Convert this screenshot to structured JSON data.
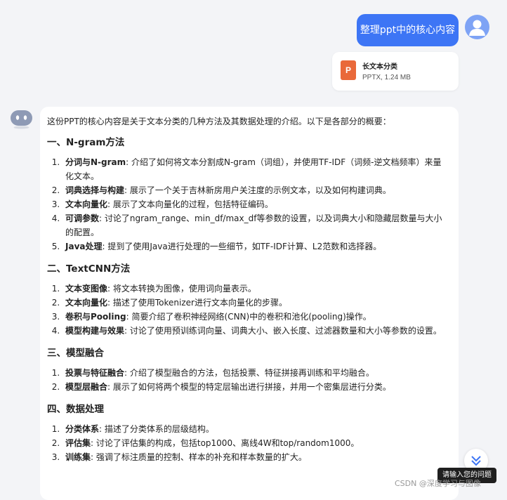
{
  "user_message": {
    "text": "整理ppt中的核心内容"
  },
  "attachment": {
    "name": "长文本分类",
    "type": "PPTX",
    "size": "1.24 MB",
    "meta": "PPTX, 1.24 MB",
    "icon_letter": "P",
    "icon_color": "#e9693a"
  },
  "answer": {
    "intro": "这份PPT的核心内容是关于文本分类的几种方法及其数据处理的介绍。以下是各部分的概要：",
    "sections": [
      {
        "title": "一、N-gram方法",
        "items": [
          {
            "term": "分词与N-gram",
            "desc": ": 介绍了如何将文本分割成N-gram（词组），并使用TF-IDF（词频-逆文档频率）来量化文本。"
          },
          {
            "term": "词典选择与构建",
            "desc": ": 展示了一个关于吉林新房用户关注度的示例文本，以及如何构建词典。"
          },
          {
            "term": "文本向量化",
            "desc": ": 展示了文本向量化的过程，包括特征编码。"
          },
          {
            "term": "可调参数",
            "desc": ": 讨论了ngram_range、min_df/max_df等参数的设置，以及词典大小和隐藏层数量与大小的配置。"
          },
          {
            "term": "Java处理",
            "desc": ": 提到了使用Java进行处理的一些细节，如TF-IDF计算、L2范数和选择器。"
          }
        ]
      },
      {
        "title": "二、TextCNN方法",
        "items": [
          {
            "term": "文本变图像",
            "desc": ": 将文本转换为图像，使用词向量表示。"
          },
          {
            "term": "文本向量化",
            "desc": ": 描述了使用Tokenizer进行文本向量化的步骤。"
          },
          {
            "term": "卷积与Pooling",
            "desc": ": 简要介绍了卷积神经网络(CNN)中的卷积和池化(pooling)操作。"
          },
          {
            "term": "模型构建与效果",
            "desc": ": 讨论了使用预训练词向量、词典大小、嵌入长度、过滤器数量和大小等参数的设置。"
          }
        ]
      },
      {
        "title": "三、模型融合",
        "items": [
          {
            "term": "投票与特征融合",
            "desc": ": 介绍了模型融合的方法，包括投票、特征拼接再训练和平均融合。"
          },
          {
            "term": "模型层融合",
            "desc": ": 展示了如何将两个模型的特定层输出进行拼接，并用一个密集层进行分类。"
          }
        ]
      },
      {
        "title": "四、数据处理",
        "items": [
          {
            "term": "分类体系",
            "desc": ": 描述了分类体系的层级结构。"
          },
          {
            "term": "评估集",
            "desc": ": 讨论了评估集的构成，包括top1000、离线4W和top/random1000。"
          },
          {
            "term": "训练集",
            "desc": ": 强调了标注质量的控制、样本的补充和样本数量的扩大。"
          }
        ]
      }
    ]
  },
  "tooltip": {
    "text": "请输入您的问题"
  },
  "watermark": {
    "text": "CSDN @深度学习与图像"
  },
  "colors": {
    "accent": "#3d75f5",
    "background": "#f3f4f7"
  }
}
